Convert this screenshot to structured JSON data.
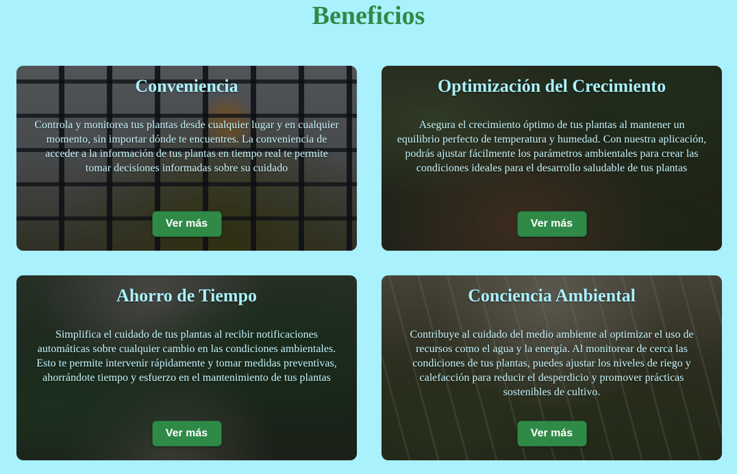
{
  "page": {
    "title": "Beneficios"
  },
  "cards": [
    {
      "title": "Conveniencia",
      "text": "Controla y monitorea tus plantas desde cualquier lugar y en cualquier momento, sin importar dónde te encuentres. La conveniencia de acceder a la información de tus plantas en tiempo real te permite tomar decisiones informadas sobre su cuidado",
      "button": "Ver más"
    },
    {
      "title": "Optimización del Crecimiento",
      "text": "Asegura el crecimiento óptimo de tus plantas al mantener un equilibrio perfecto de temperatura y humedad. Con nuestra aplicación, podrás ajustar fácilmente los parámetros ambientales para crear las condiciones ideales para el desarrollo saludable de tus plantas",
      "button": "Ver más"
    },
    {
      "title": "Ahorro de Tiempo",
      "text": "Simplifica el cuidado de tus plantas al recibir notificaciones automáticas sobre cualquier cambio en las condiciones ambientales. Esto te permite intervenir rápidamente y tomar medidas preventivas, ahorrándote tiempo y esfuerzo en el mantenimiento de tus plantas",
      "button": "Ver más"
    },
    {
      "title": "Conciencia Ambiental",
      "text": "Contribuye al cuidado del medio ambiente al optimizar el uso de recursos como el agua y la energía. Al monitorear de cerca las condiciones de tus plantas, puedes ajustar los niveles de riego y calefacción para reducir el desperdicio y promover prácticas sostenibles de cultivo.",
      "button": "Ver más"
    }
  ],
  "colors": {
    "background": "#a9f1fc",
    "heading": "#2f8a47",
    "card_title": "#a9f1fc",
    "button": "#2f8a47",
    "button_text": "#ffffff"
  }
}
